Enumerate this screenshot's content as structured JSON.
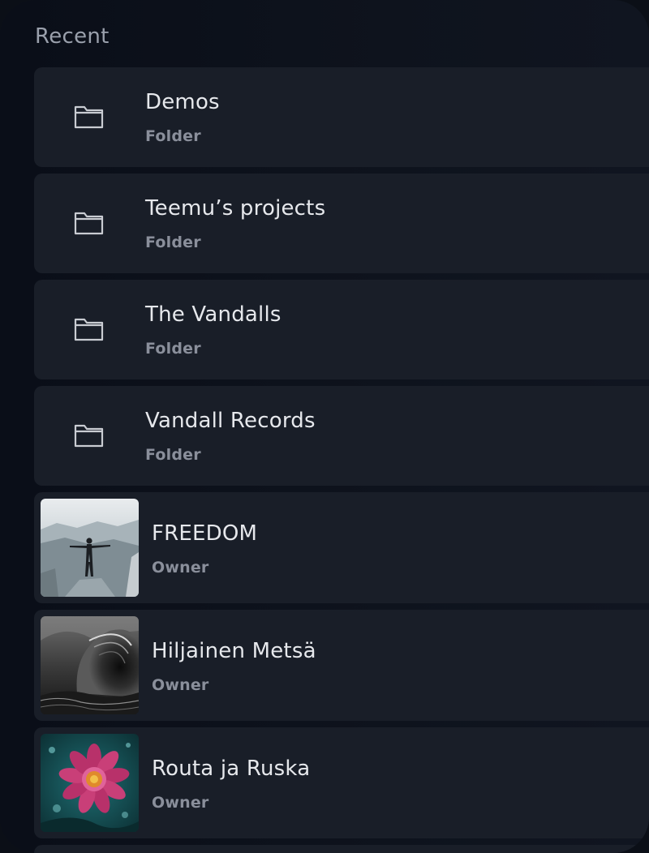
{
  "section": {
    "title": "Recent"
  },
  "items": [
    {
      "kind": "folder",
      "title": "Demos",
      "subtitle": "Folder",
      "icon": "folder-icon"
    },
    {
      "kind": "folder",
      "title": "Teemu’s projects",
      "subtitle": "Folder",
      "icon": "folder-icon"
    },
    {
      "kind": "folder",
      "title": "The Vandalls",
      "subtitle": "Folder",
      "icon": "folder-icon"
    },
    {
      "kind": "folder",
      "title": "Vandall Records",
      "subtitle": "Folder",
      "icon": "folder-icon"
    },
    {
      "kind": "track",
      "title": "FREEDOM",
      "subtitle": "Owner",
      "cover": "person-on-cliff-artwork"
    },
    {
      "kind": "track",
      "title": "Hiljainen Metsä",
      "subtitle": "Owner",
      "cover": "dark-wave-artwork"
    },
    {
      "kind": "track",
      "title": "Routa ja Ruska",
      "subtitle": "Owner",
      "cover": "flower-artwork"
    }
  ],
  "colors": {
    "background": "#0b0f17",
    "row": "#191e28",
    "title": "#e6e8ec",
    "subtitle": "#8a8f9b",
    "section_title": "#9aa0ac"
  }
}
